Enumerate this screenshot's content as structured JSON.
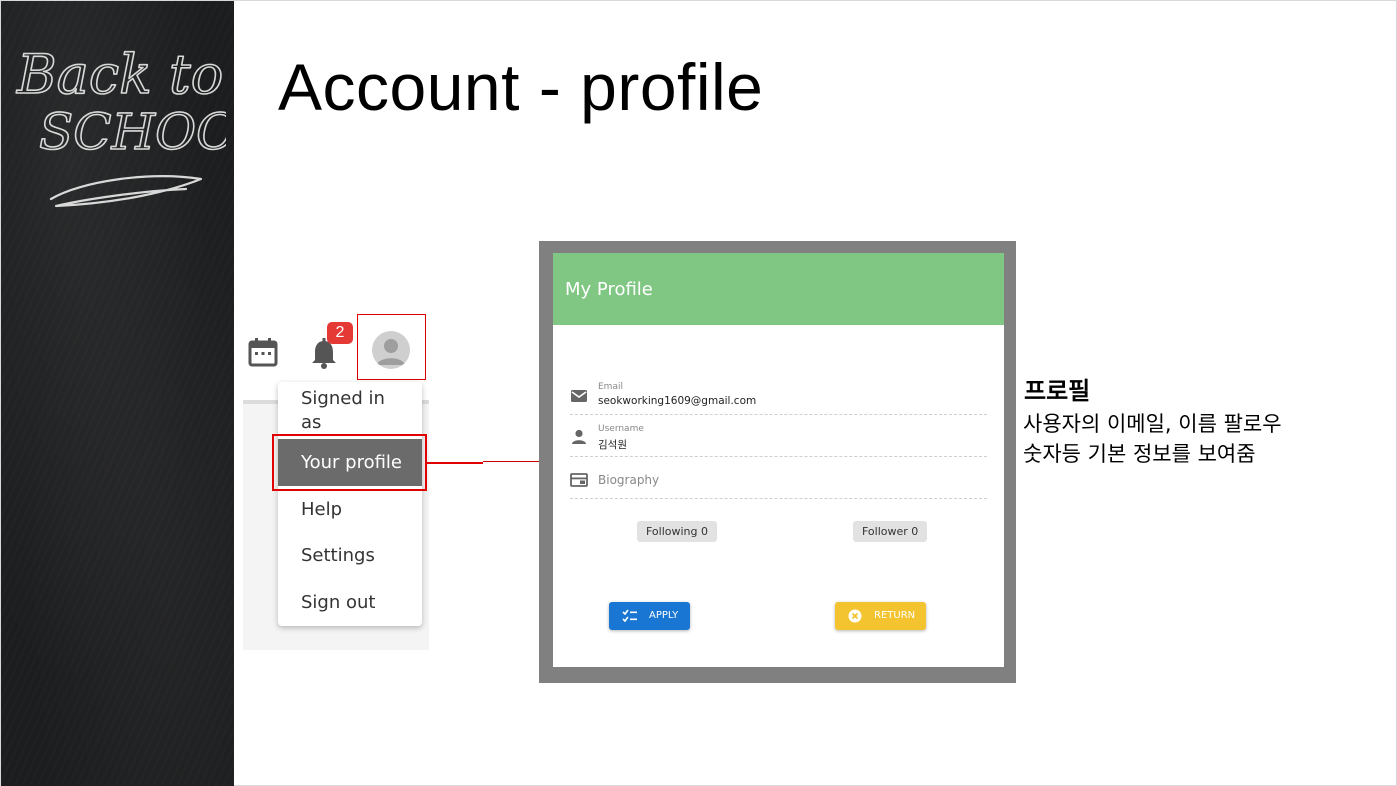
{
  "slide": {
    "title": "Account - profile",
    "decoration": {
      "chalk_text_line1": "Back to",
      "chalk_text_line2": "SCHOOL"
    }
  },
  "topbar": {
    "icons": [
      "calendar-icon",
      "bell-icon",
      "avatar-icon"
    ],
    "notification_count": "2"
  },
  "user_menu": {
    "items": [
      {
        "label": "Signed in as"
      },
      {
        "label": "Your profile",
        "selected": true
      },
      {
        "label": "Help"
      },
      {
        "label": "Settings"
      },
      {
        "label": "Sign out"
      }
    ]
  },
  "profile_dialog": {
    "title": "My Profile",
    "header_color": "#81c784",
    "email": {
      "label": "Email",
      "value": "seokworking1609@gmail.com",
      "icon": "mail-icon"
    },
    "username": {
      "label": "Username",
      "value": "김석원",
      "icon": "person-icon"
    },
    "biography": {
      "placeholder": "Biography",
      "icon": "card-icon"
    },
    "following": "Following 0",
    "follower": "Follower 0",
    "apply_label": "APPLY",
    "return_label": "RETURN",
    "apply_color": "#1976d2",
    "return_color": "#f4c430"
  },
  "annotation": {
    "title": "프로필",
    "line1": "사용자의 이메일, 이름 팔로우",
    "line2": "숫자등 기본 정보를 보여줌"
  },
  "highlight_color": "#e00000"
}
